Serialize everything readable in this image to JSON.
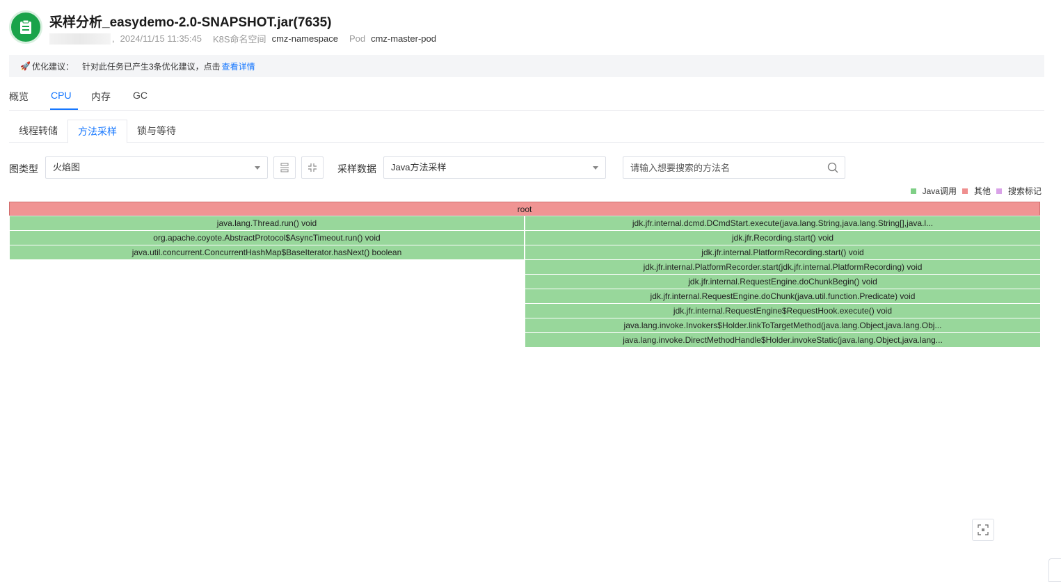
{
  "header": {
    "title": "采样分析_easydemo-2.0-SNAPSHOT.jar(7635)",
    "separator": ",",
    "date": "2024/11/15 11:35:45",
    "namespace_label": "K8S命名空间",
    "namespace_value": "cmz-namespace",
    "pod_label": "Pod",
    "pod_value": "cmz-master-pod"
  },
  "suggestion": {
    "label": "优化建议：",
    "text": "针对此任务已产生3条优化建议，点击",
    "link": "查看详情"
  },
  "tabs": [
    "概览",
    "CPU",
    "内存",
    "GC"
  ],
  "active_tab": "CPU",
  "subtabs": [
    "线程转储",
    "方法采样",
    "锁与等待"
  ],
  "active_subtab": "方法采样",
  "toolbar": {
    "chart_type_label": "图类型",
    "chart_type_value": "火焰图",
    "sample_data_label": "采样数据",
    "sample_data_value": "Java方法采样",
    "search_placeholder": "请输入想要搜索的方法名"
  },
  "legend": [
    {
      "label": "Java调用",
      "color": "#7fcf86"
    },
    {
      "label": "其他",
      "color": "#ef8f8f"
    },
    {
      "label": "搜索标记",
      "color": "#d9a2e8"
    }
  ],
  "colors": {
    "accent": "#1677ff",
    "java": "#98d79b",
    "root": "#f09493"
  },
  "flame": {
    "root": "root",
    "left": [
      "java.lang.Thread.run() void",
      "org.apache.coyote.AbstractProtocol$AsyncTimeout.run() void",
      "java.util.concurrent.ConcurrentHashMap$BaseIterator.hasNext() boolean"
    ],
    "right": [
      "jdk.jfr.internal.dcmd.DCmdStart.execute(java.lang.String,java.lang.String[],java.l...",
      "jdk.jfr.Recording.start() void",
      "jdk.jfr.internal.PlatformRecording.start() void",
      "jdk.jfr.internal.PlatformRecorder.start(jdk.jfr.internal.PlatformRecording) void",
      "jdk.jfr.internal.RequestEngine.doChunkBegin() void",
      "jdk.jfr.internal.RequestEngine.doChunk(java.util.function.Predicate) void",
      "jdk.jfr.internal.RequestEngine$RequestHook.execute() void",
      "java.lang.invoke.Invokers$Holder.linkToTargetMethod(java.lang.Object,java.lang.Obj...",
      "java.lang.invoke.DirectMethodHandle$Holder.invokeStatic(java.lang.Object,java.lang..."
    ]
  }
}
